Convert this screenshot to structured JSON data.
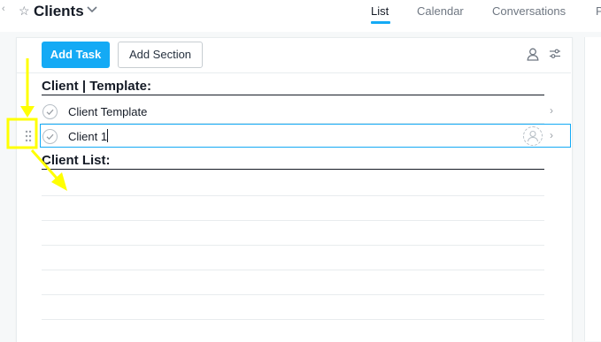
{
  "header": {
    "project_title": "Clients",
    "tabs": [
      {
        "label": "List",
        "active": true
      },
      {
        "label": "Calendar",
        "active": false
      },
      {
        "label": "Conversations",
        "active": false
      },
      {
        "label": "P",
        "active": false
      }
    ]
  },
  "toolbar": {
    "add_task_label": "Add Task",
    "add_section_label": "Add Section",
    "icons": [
      "user-icon",
      "filter-sliders-icon"
    ]
  },
  "sections": [
    {
      "title": "Client | Template:",
      "tasks": [
        {
          "name": "Client Template",
          "selected": false
        },
        {
          "name": "Client 1",
          "selected": true
        }
      ]
    },
    {
      "title": "Client List:",
      "tasks": []
    }
  ],
  "colors": {
    "accent": "#14aaf5",
    "annotation": "#ffff00",
    "text": "#151b26"
  }
}
